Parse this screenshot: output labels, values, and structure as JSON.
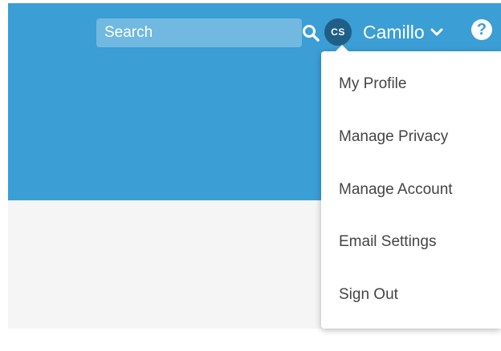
{
  "header": {
    "search": {
      "placeholder": "Search",
      "icon": "search-icon"
    },
    "user": {
      "initials": "CS",
      "name": "Camillo",
      "chevron_icon": "chevron-down-icon"
    },
    "help": {
      "icon": "help-icon",
      "glyph": "?"
    }
  },
  "dropdown": {
    "items": [
      {
        "label": "My Profile"
      },
      {
        "label": "Manage Privacy"
      },
      {
        "label": "Manage Account"
      },
      {
        "label": "Email Settings"
      },
      {
        "label": "Sign Out"
      }
    ]
  },
  "colors": {
    "header_bg": "#3b9ed5",
    "avatar_bg": "#1f5f86",
    "menu_text": "#444444",
    "content_bg": "#f5f5f5"
  }
}
